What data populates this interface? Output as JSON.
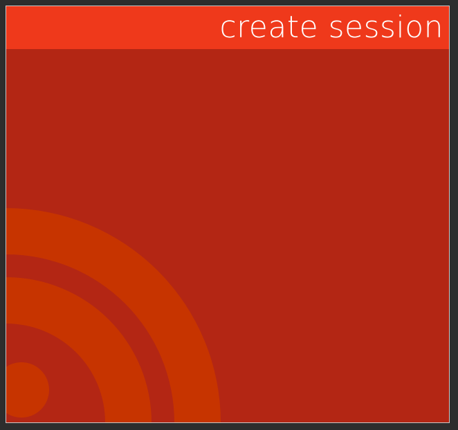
{
  "tile": {
    "title": "create session",
    "icon": "broadcast-icon",
    "colors": {
      "background": "#b32614",
      "header": "#ef391b",
      "icon": "#c73400",
      "text": "#ffffff",
      "page": "#2d2d2d"
    }
  }
}
